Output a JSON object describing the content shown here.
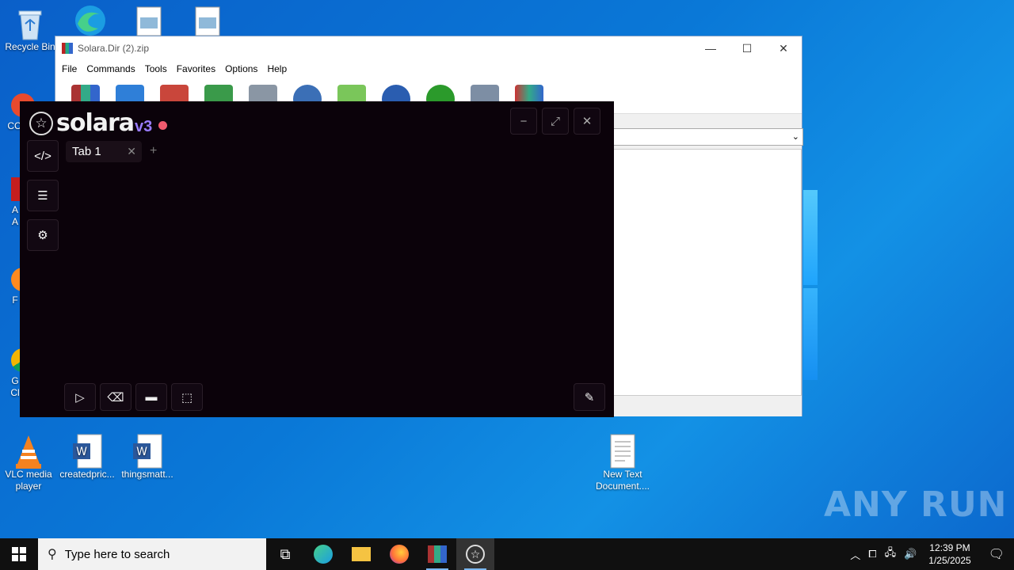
{
  "desktop": {
    "icons": [
      {
        "label": "Recycle Bin"
      },
      {
        "label": "VLC media player"
      },
      {
        "label": "createdpric..."
      },
      {
        "label": "thingsmatt..."
      },
      {
        "label": "New Text Document...."
      }
    ],
    "partial_labels": [
      "CC",
      "A",
      "A",
      "F",
      "G",
      "Cl"
    ]
  },
  "winrar": {
    "title": "Solara.Dir (2).zip",
    "menu": [
      "File",
      "Commands",
      "Tools",
      "Favorites",
      "Options",
      "Help"
    ],
    "controls": {
      "minimize": "—",
      "maximize": "☐",
      "close": "✕"
    }
  },
  "solara": {
    "brand": "solara",
    "version": "v3",
    "tab_label": "Tab 1",
    "tab_close": "✕",
    "add_tab": "+",
    "win_minimize": "−",
    "win_maximize": "⤢",
    "win_close": "✕",
    "side_code": "</>",
    "side_list": "☰",
    "side_settings": "⚙",
    "btn_run": "▷",
    "btn_clear": "⌫",
    "btn_open": "▬",
    "btn_save": "⬚",
    "btn_attach": "✎"
  },
  "watermark": "ANY RUN",
  "taskbar": {
    "search_placeholder": "Type here to search",
    "time": "12:39 PM",
    "date": "1/25/2025"
  },
  "colors": {
    "solara_bg": "#0b020a",
    "solara_accent": "#9a7cff",
    "status_dot": "#f05a6e",
    "taskbar_bg": "#101010"
  }
}
